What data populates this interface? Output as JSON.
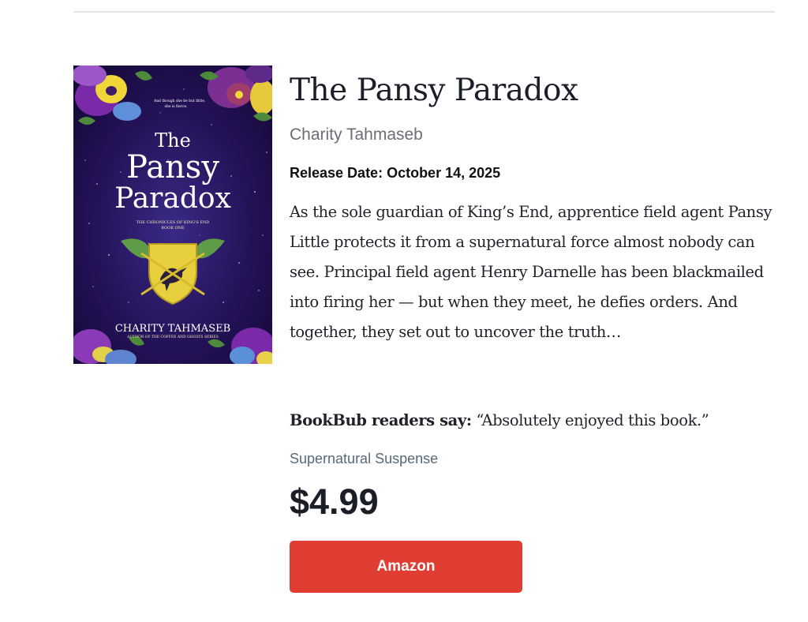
{
  "book": {
    "title": "The Pansy Paradox",
    "author": "Charity Tahmaseb",
    "release_date": "Release Date: October 14, 2025",
    "description": "As the sole guardian of King’s End, apprentice field agent Pansy Little protects it from a supernatural force almost nobody can see. Principal field agent Henry Darnelle has been blackmailed into firing her — but when they meet, he defies orders. And together, they set out to uncover the truth…",
    "readers_label": "BookBub readers say:",
    "readers_quote": "“Absolutely enjoyed this book.”",
    "genre": "Supernatural Suspense",
    "price": "$4.99",
    "buy_button_label": "Amazon"
  },
  "cover": {
    "tagline_line1": "And though she be but little,",
    "tagline_line2": "she is fierce.",
    "title_line1": "The",
    "title_line2": "Pansy",
    "title_line3": "Paradox",
    "series_line1": "THE CHRONICLES OF KING'S END",
    "series_line2": "BOOK ONE",
    "author": "CHARITY TAHMASEB",
    "author_note": "AUTHOR OF THE COFFEE AND GHOSTS SERIES"
  },
  "colors": {
    "button": "#e03d33",
    "genre": "#56697a",
    "cover_background": "#2a1660"
  }
}
